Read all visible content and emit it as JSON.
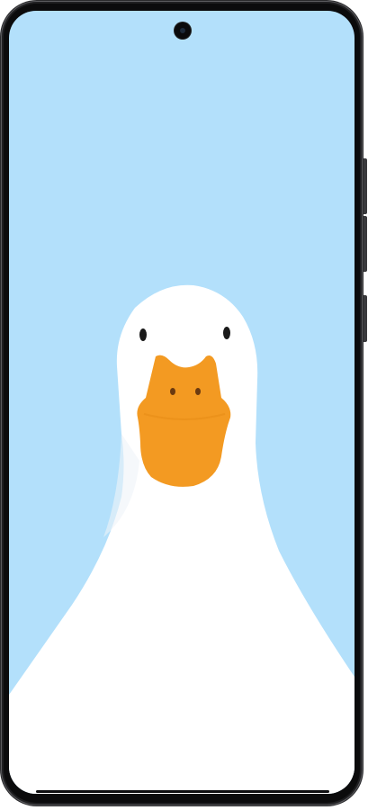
{
  "device": {
    "frame_color": "#1f1f21",
    "bezel_color": "#0b0b0c",
    "button_color": "#3a3a3d"
  },
  "wallpaper": {
    "subject": "duck",
    "background_color": "#b3e0fb",
    "body_color": "#ffffff",
    "beak_color": "#f39a22",
    "eye_color": "#1a1a1a",
    "nostril_color": "#6b3a10"
  }
}
